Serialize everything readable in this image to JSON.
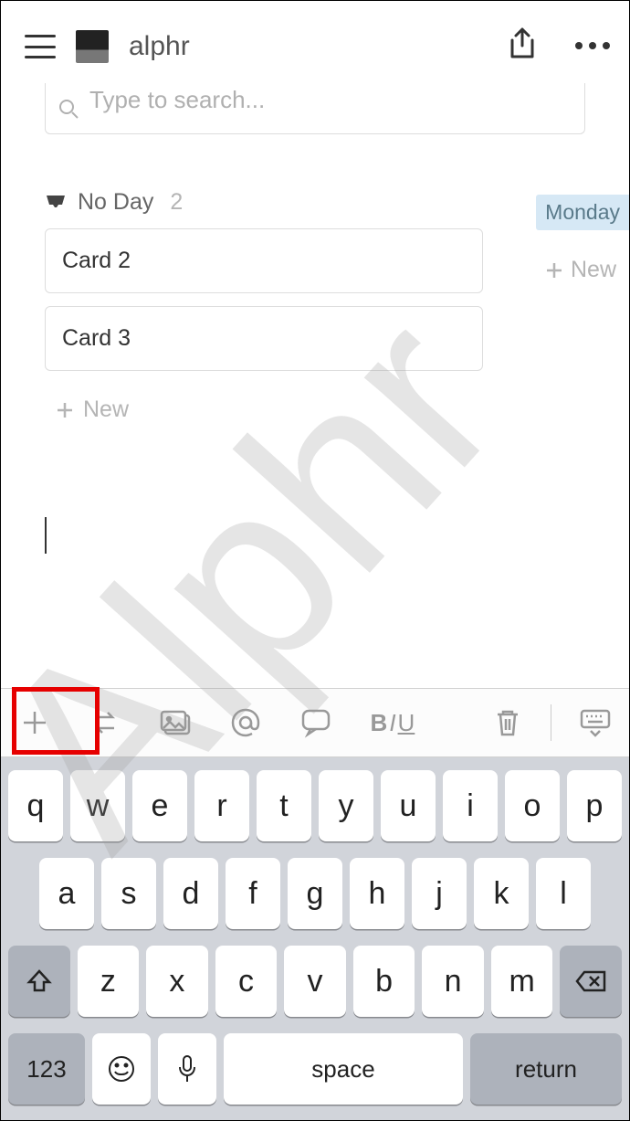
{
  "header": {
    "title": "alphr"
  },
  "search": {
    "placeholder": "Type to search..."
  },
  "group": {
    "label": "No Day",
    "count": "2",
    "day_tag": "Monday"
  },
  "cards": [
    "Card 2",
    "Card 3"
  ],
  "new_label": "New",
  "side_new_label": "New",
  "toolbar": {
    "format_label_b": "B",
    "format_label_i": "I",
    "format_label_u": "U"
  },
  "keyboard": {
    "row1": [
      "q",
      "w",
      "e",
      "r",
      "t",
      "y",
      "u",
      "i",
      "o",
      "p"
    ],
    "row2": [
      "a",
      "s",
      "d",
      "f",
      "g",
      "h",
      "j",
      "k",
      "l"
    ],
    "row3": [
      "z",
      "x",
      "c",
      "v",
      "b",
      "n",
      "m"
    ],
    "numbers": "123",
    "space": "space",
    "return": "return"
  },
  "watermark_text": "Alphr"
}
